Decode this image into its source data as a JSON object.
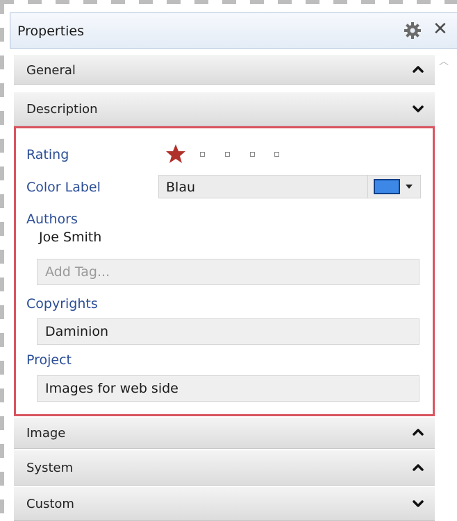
{
  "panel": {
    "title": "Properties",
    "icons": {
      "settings": "gear-icon",
      "close": "close-icon"
    },
    "close_glyph": "✕"
  },
  "sections": {
    "general": {
      "label": "General",
      "state": "collapsed"
    },
    "description": {
      "label": "Description",
      "state": "expanded",
      "rating": {
        "label": "Rating",
        "value": 1,
        "max": 5
      },
      "color_label": {
        "label": "Color Label",
        "value": "Blau",
        "swatch_color": "#3d87e6"
      },
      "authors": {
        "label": "Authors",
        "items": [
          "Joe Smith"
        ],
        "add_placeholder": "Add Tag..."
      },
      "copyrights": {
        "label": "Copyrights",
        "value": "Daminion"
      },
      "project": {
        "label": "Project",
        "value": "Images for web side"
      }
    },
    "image": {
      "label": "Image",
      "state": "collapsed"
    },
    "system": {
      "label": "System",
      "state": "collapsed"
    },
    "custom": {
      "label": "Custom",
      "state": "expanded"
    }
  },
  "colors": {
    "highlight_border": "#d9545f",
    "field_label": "#2b4e97",
    "star": "#b0302a"
  }
}
